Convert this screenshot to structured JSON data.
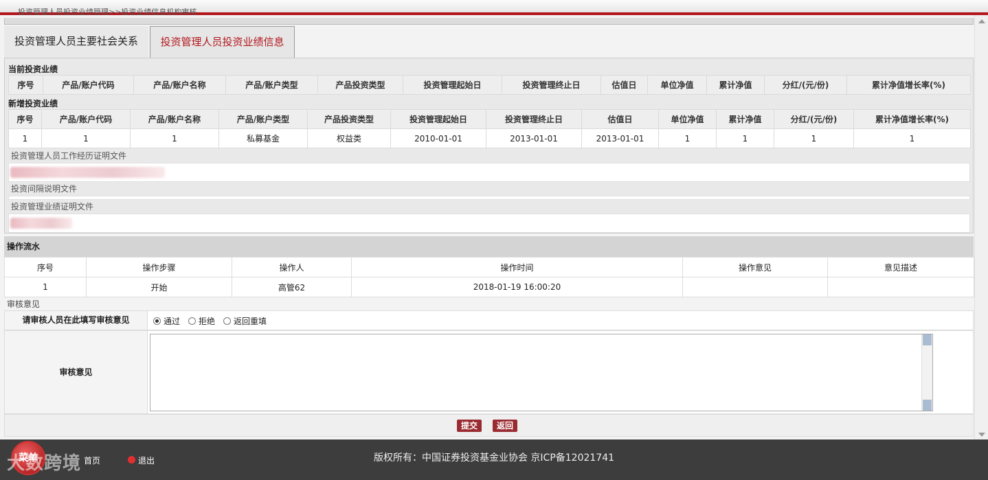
{
  "breadcrumb": "投资管理人员投资业绩管理>>投资业绩信息机构审核",
  "tabs": [
    "投资管理人员主要社会关系",
    "投资管理人员投资业绩信息"
  ],
  "current_perf": {
    "title": "当前投资业绩",
    "headers": [
      "序号",
      "产品/账户代码",
      "产品/账户名称",
      "产品/账户类型",
      "产品投资类型",
      "投资管理起始日",
      "投资管理终止日",
      "估值日",
      "单位净值",
      "累计净值",
      "分红/(元/份)",
      "累计净值增长率(%)"
    ]
  },
  "new_perf": {
    "title": "新增投资业绩",
    "headers": [
      "序号",
      "产品/账户代码",
      "产品/账户名称",
      "产品/账户类型",
      "产品投资类型",
      "投资管理起始日",
      "投资管理终止日",
      "估值日",
      "单位净值",
      "累计净值",
      "分红/(元/份)",
      "累计净值增长率(%)"
    ],
    "rows": [
      [
        "1",
        "1",
        "1",
        "私募基金",
        "权益类",
        "2010-01-01",
        "2013-01-01",
        "2013-01-01",
        "1",
        "1",
        "1",
        "1"
      ]
    ]
  },
  "files": {
    "work_proof": "投资管理人员工作经历证明文件",
    "gap_note": "投资间隔说明文件",
    "perf_proof": "投资管理业绩证明文件"
  },
  "flow": {
    "title": "操作流水",
    "headers": [
      "序号",
      "操作步骤",
      "操作人",
      "操作时间",
      "操作意见",
      "意见描述"
    ],
    "rows": [
      [
        "1",
        "开始",
        "高管62",
        "2018-01-19 16:00:20",
        "",
        ""
      ]
    ]
  },
  "review": {
    "section_label": "审核意见",
    "prompt": "请审核人员在此填写审核意见",
    "options": [
      "通过",
      "拒绝",
      "返回重填"
    ],
    "selected": "通过",
    "opinion_label": "审核意见"
  },
  "buttons": {
    "submit": "提交",
    "back": "返回"
  },
  "footer": {
    "copyright": "版权所有：中国证券投资基金业协会 京ICP备12021741",
    "menu": "菜单",
    "home": "首页",
    "exit": "退出",
    "watermark": "大数跨境"
  },
  "colors": {
    "accent": "#b3161c",
    "button": "#9a2b31",
    "footer": "#3d3d3d"
  }
}
